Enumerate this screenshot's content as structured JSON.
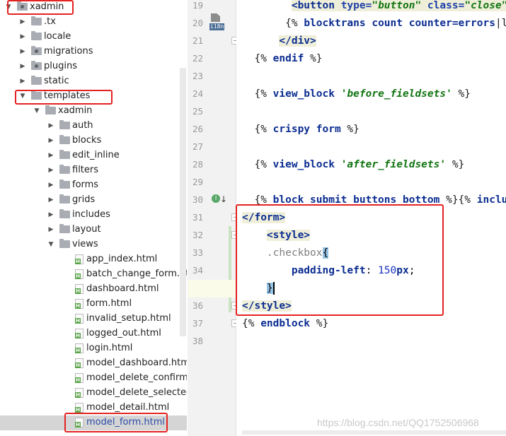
{
  "tree": {
    "items": [
      {
        "label": "xadmin",
        "icon": "folder-dot-icon",
        "arrow": "down"
      },
      {
        "label": ".tx",
        "icon": "folder-icon",
        "arrow": "right"
      },
      {
        "label": "locale",
        "icon": "folder-icon",
        "arrow": "right"
      },
      {
        "label": "migrations",
        "icon": "folder-dot-icon",
        "arrow": "right"
      },
      {
        "label": "plugins",
        "icon": "folder-dot-icon",
        "arrow": "right"
      },
      {
        "label": "static",
        "icon": "folder-icon",
        "arrow": "right"
      },
      {
        "label": "templates",
        "icon": "folder-icon",
        "arrow": "down"
      },
      {
        "label": "xadmin",
        "icon": "folder-icon",
        "arrow": "down"
      },
      {
        "label": "auth",
        "icon": "folder-icon",
        "arrow": "right"
      },
      {
        "label": "blocks",
        "icon": "folder-icon",
        "arrow": "right"
      },
      {
        "label": "edit_inline",
        "icon": "folder-icon",
        "arrow": "right"
      },
      {
        "label": "filters",
        "icon": "folder-icon",
        "arrow": "right"
      },
      {
        "label": "forms",
        "icon": "folder-icon",
        "arrow": "right"
      },
      {
        "label": "grids",
        "icon": "folder-icon",
        "arrow": "right"
      },
      {
        "label": "includes",
        "icon": "folder-icon",
        "arrow": "right"
      },
      {
        "label": "layout",
        "icon": "folder-icon",
        "arrow": "right"
      },
      {
        "label": "views",
        "icon": "folder-icon",
        "arrow": "down"
      },
      {
        "label": "app_index.html",
        "icon": "html-file-icon",
        "arrow": ""
      },
      {
        "label": "batch_change_form.html",
        "icon": "html-file-icon",
        "arrow": ""
      },
      {
        "label": "dashboard.html",
        "icon": "html-file-icon",
        "arrow": ""
      },
      {
        "label": "form.html",
        "icon": "html-file-icon",
        "arrow": ""
      },
      {
        "label": "invalid_setup.html",
        "icon": "html-file-icon",
        "arrow": ""
      },
      {
        "label": "logged_out.html",
        "icon": "html-file-icon",
        "arrow": ""
      },
      {
        "label": "login.html",
        "icon": "html-file-icon",
        "arrow": ""
      },
      {
        "label": "model_dashboard.html",
        "icon": "html-file-icon",
        "arrow": ""
      },
      {
        "label": "model_delete_confirm.ht",
        "icon": "html-file-icon",
        "arrow": ""
      },
      {
        "label": "model_delete_selected_c",
        "icon": "html-file-icon",
        "arrow": ""
      },
      {
        "label": "model_detail.html",
        "icon": "html-file-icon",
        "arrow": ""
      },
      {
        "label": "model_form.html",
        "icon": "html-file-icon",
        "arrow": "",
        "selected": true
      }
    ]
  },
  "editor": {
    "line_numbers": [
      "19",
      "20",
      "21",
      "22",
      "23",
      "24",
      "25",
      "26",
      "27",
      "28",
      "29",
      "30",
      "31",
      "32",
      "33",
      "34",
      "35",
      "36",
      "37",
      "38"
    ],
    "lines": [
      [
        {
          "t": "        ",
          "c": "t-plain"
        },
        {
          "t": "<button ",
          "c": "t-tag tagbg"
        },
        {
          "t": "type=",
          "c": "t-attr tagbg"
        },
        {
          "t": "\"button\" ",
          "c": "t-str tagbg"
        },
        {
          "t": "class=",
          "c": "t-attr tagbg"
        },
        {
          "t": "\"close\"",
          "c": "t-str tagbg"
        }
      ],
      [
        {
          "t": "       {% ",
          "c": "t-dj"
        },
        {
          "t": "blocktrans count counter=errors",
          "c": "t-kw"
        },
        {
          "t": "|le",
          "c": "t-dj"
        }
      ],
      [
        {
          "t": "      ",
          "c": "t-plain"
        },
        {
          "t": "</div>",
          "c": "t-tag tagbg"
        }
      ],
      [
        {
          "t": "  {% ",
          "c": "t-dj"
        },
        {
          "t": "endif",
          "c": "t-kw"
        },
        {
          "t": " %}",
          "c": "t-dj"
        }
      ],
      [
        {
          "t": "",
          "c": "t-plain"
        }
      ],
      [
        {
          "t": "  {% ",
          "c": "t-dj"
        },
        {
          "t": "view_block ",
          "c": "t-kw"
        },
        {
          "t": "'before_fieldsets'",
          "c": "t-str"
        },
        {
          "t": " %}",
          "c": "t-dj"
        }
      ],
      [
        {
          "t": "",
          "c": "t-plain"
        }
      ],
      [
        {
          "t": "  {% ",
          "c": "t-dj"
        },
        {
          "t": "crispy form",
          "c": "t-kw"
        },
        {
          "t": " %}",
          "c": "t-dj"
        }
      ],
      [
        {
          "t": "",
          "c": "t-plain"
        }
      ],
      [
        {
          "t": "  {% ",
          "c": "t-dj"
        },
        {
          "t": "view_block ",
          "c": "t-kw"
        },
        {
          "t": "'after_fieldsets'",
          "c": "t-str"
        },
        {
          "t": " %}",
          "c": "t-dj"
        }
      ],
      [
        {
          "t": "",
          "c": "t-plain"
        }
      ],
      [
        {
          "t": "  {% ",
          "c": "t-dj"
        },
        {
          "t": "block_submit_buttons_bottom",
          "c": "t-kw"
        },
        {
          "t": " %}{% ",
          "c": "t-dj"
        },
        {
          "t": "inclu",
          "c": "t-kw"
        }
      ],
      [
        {
          "t": "</form>",
          "c": "t-tag tagbg"
        }
      ],
      [
        {
          "t": "    ",
          "c": "t-plain"
        },
        {
          "t": "<style>",
          "c": "t-tag tagbg"
        }
      ],
      [
        {
          "t": "    ",
          "c": "t-plain"
        },
        {
          "t": ".checkbox",
          "c": "t-sel"
        },
        {
          "t": "{",
          "c": "t-plain matchbrace"
        }
      ],
      [
        {
          "t": "        ",
          "c": "t-plain"
        },
        {
          "t": "padding-left",
          "c": "t-prop"
        },
        {
          "t": ": ",
          "c": "t-plain"
        },
        {
          "t": "150",
          "c": "t-num"
        },
        {
          "t": "px",
          "c": "t-prop"
        },
        {
          "t": ";",
          "c": "t-plain"
        }
      ],
      [
        {
          "t": "    ",
          "c": "t-plain"
        },
        {
          "t": "}",
          "c": "t-plain matchbrace"
        },
        {
          "t": "",
          "c": "cursor"
        }
      ],
      [
        {
          "t": "</style>",
          "c": "t-tag tagbg"
        }
      ],
      [
        {
          "t": "{% ",
          "c": "t-dj"
        },
        {
          "t": "endblock",
          "c": "t-kw"
        },
        {
          "t": " %}",
          "c": "t-dj"
        }
      ],
      [
        {
          "t": "",
          "c": "t-plain"
        }
      ]
    ]
  },
  "gutter": {
    "i18n_badge": "i18n",
    "override_badge": "I"
  },
  "watermark": "https://blog.csdn.net/QQ1752506968",
  "colors": {
    "highlight_box": "#e52222",
    "selection": "#d5d5d5",
    "tag": "#0b2d91",
    "string": "#127512"
  }
}
